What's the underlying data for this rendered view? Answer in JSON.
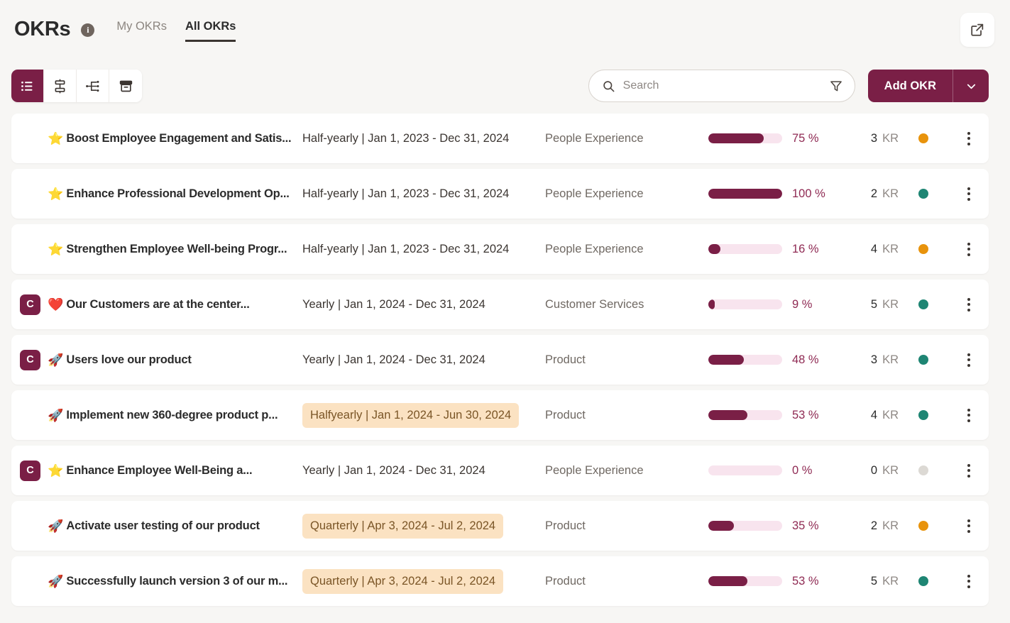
{
  "header": {
    "title": "OKRs",
    "info_icon": "info-icon",
    "tabs": [
      {
        "label": "My OKRs",
        "active": false
      },
      {
        "label": "All OKRs",
        "active": true
      }
    ],
    "open_external_icon": "external-link-icon"
  },
  "toolbar": {
    "views": [
      {
        "name": "list-view",
        "icon": "list-icon",
        "active": true
      },
      {
        "name": "alignment-view",
        "icon": "alignment-icon",
        "active": false
      },
      {
        "name": "tree-view",
        "icon": "tree-icon",
        "active": false
      },
      {
        "name": "archive-view",
        "icon": "archive-icon",
        "active": false
      }
    ],
    "search": {
      "placeholder": "Search",
      "value": "",
      "search_icon": "search-icon",
      "filter_icon": "filter-icon"
    },
    "add_okr_label": "Add OKR",
    "add_okr_caret_icon": "chevron-down-icon"
  },
  "colors": {
    "accent": "#7A1F46",
    "progress_track": "#F8E4EE",
    "percent_text": "#8F2A53",
    "badge_bg": "#FBE2C2",
    "badge_text": "#7A5526",
    "status_at_risk": "#E8930C",
    "status_on_track": "#1E8573",
    "status_none": "#DCD9D4",
    "page_bg": "#F7F6F4"
  },
  "kr_label": "KR",
  "rows": [
    {
      "level": "",
      "emoji": "⭐",
      "title": "Boost Employee Engagement and Satis...",
      "period": "Half-yearly | Jan 1, 2023 - Dec 31, 2024",
      "period_highlight": false,
      "team": "People Experience",
      "progress": 75,
      "progress_label": "75 %",
      "kr_count": "3",
      "status": "at_risk"
    },
    {
      "level": "",
      "emoji": "⭐",
      "title": "Enhance Professional Development Op...",
      "period": "Half-yearly | Jan 1, 2023 - Dec 31, 2024",
      "period_highlight": false,
      "team": "People Experience",
      "progress": 100,
      "progress_label": "100 %",
      "kr_count": "2",
      "status": "on_track"
    },
    {
      "level": "",
      "emoji": "⭐",
      "title": "Strengthen Employee Well-being Progr...",
      "period": "Half-yearly | Jan 1, 2023 - Dec 31, 2024",
      "period_highlight": false,
      "team": "People Experience",
      "progress": 16,
      "progress_label": "16 %",
      "kr_count": "4",
      "status": "at_risk"
    },
    {
      "level": "C",
      "emoji": "❤️",
      "title": "Our Customers are at the center...",
      "period": "Yearly | Jan 1, 2024 - Dec 31, 2024",
      "period_highlight": false,
      "team": "Customer Services",
      "progress": 9,
      "progress_label": "9 %",
      "kr_count": "5",
      "status": "on_track"
    },
    {
      "level": "C",
      "emoji": "🚀",
      "title": "Users love our product",
      "period": "Yearly | Jan 1, 2024 - Dec 31, 2024",
      "period_highlight": false,
      "team": "Product",
      "progress": 48,
      "progress_label": "48 %",
      "kr_count": "3",
      "status": "on_track"
    },
    {
      "level": "",
      "emoji": "🚀",
      "title": "Implement new 360-degree product p...",
      "period": "Halfyearly | Jan 1, 2024 - Jun 30, 2024",
      "period_highlight": true,
      "team": "Product",
      "progress": 53,
      "progress_label": "53 %",
      "kr_count": "4",
      "status": "on_track"
    },
    {
      "level": "C",
      "emoji": "⭐",
      "title": "Enhance Employee Well-Being a...",
      "period": "Yearly | Jan 1, 2024 - Dec 31, 2024",
      "period_highlight": false,
      "team": "People Experience",
      "progress": 0,
      "progress_label": "0 %",
      "kr_count": "0",
      "status": "none"
    },
    {
      "level": "",
      "emoji": "🚀",
      "title": "Activate user testing of our product",
      "period": "Quarterly | Apr 3, 2024 - Jul 2, 2024",
      "period_highlight": true,
      "team": "Product",
      "progress": 35,
      "progress_label": "35 %",
      "kr_count": "2",
      "status": "at_risk"
    },
    {
      "level": "",
      "emoji": "🚀",
      "title": "Successfully launch version 3 of our m...",
      "period": "Quarterly | Apr 3, 2024 - Jul 2, 2024",
      "period_highlight": true,
      "team": "Product",
      "progress": 53,
      "progress_label": "53 %",
      "kr_count": "5",
      "status": "on_track"
    }
  ]
}
